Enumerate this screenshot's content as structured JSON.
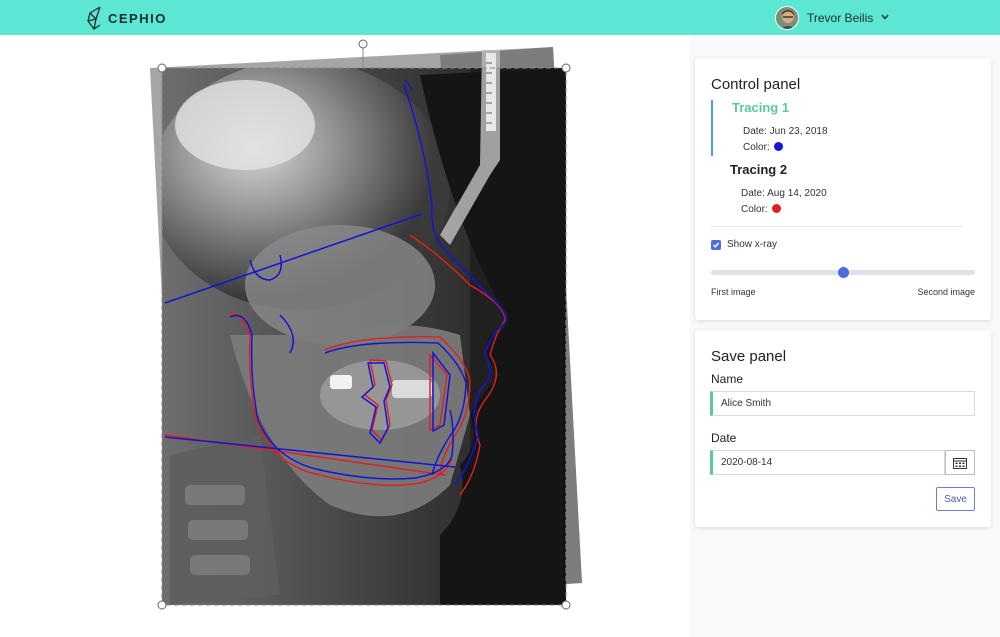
{
  "header": {
    "logo_text": "CEPHIO",
    "user_name": "Trevor Beilis"
  },
  "control_panel": {
    "title": "Control panel",
    "tracings": [
      {
        "name": "Tracing 1",
        "date": "Date: Jun 23, 2018",
        "color_label": "Color:",
        "color": "#1414d6",
        "active": true
      },
      {
        "name": "Tracing 2",
        "date": "Date: Aug 14, 2020",
        "color_label": "Color:",
        "color": "#e0201e",
        "active": false
      }
    ],
    "show_xray_label": "Show x-ray",
    "show_xray_checked": true,
    "slider_value_fraction": 0.5,
    "slider_left_label": "First image",
    "slider_right_label": "Second image"
  },
  "save_panel": {
    "title": "Save panel",
    "name_label": "Name",
    "name_value": "Alice Smith",
    "date_label": "Date",
    "date_value": "2020-08-14",
    "save_label": "Save"
  },
  "colors": {
    "header_bg": "#5ce7d3",
    "accent_green": "#5cc99a",
    "accent_blue": "#4a6ee0",
    "tracing_blue": "#1414d6",
    "tracing_red": "#e0201e"
  }
}
